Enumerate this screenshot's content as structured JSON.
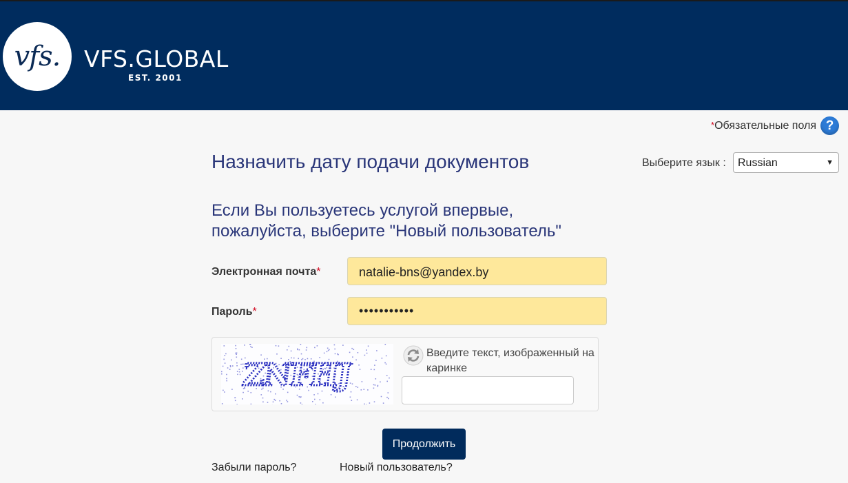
{
  "header": {
    "logo_mark": "vfs.",
    "brand": "VFS.GLOBAL",
    "est": "EST. 2001"
  },
  "required_note": {
    "star": "*",
    "text": "Обязательные поля"
  },
  "help_icon": "?",
  "icons": {
    "help": "question-circle-icon",
    "refresh": "refresh-icon",
    "select": "caret-down-icon"
  },
  "page_title": "Назначить дату подачи документов",
  "language": {
    "label": "Выберите язык :",
    "selected": "Russian"
  },
  "subtitle": {
    "line1": "Если Вы пользуетесь услугой впервые,",
    "line2": "пожалуйста, выберите \"Новый пользователь\""
  },
  "form": {
    "email_label": "Электронная почта",
    "email_value": "natalie-bns@yandex.by",
    "password_label": "Пароль",
    "password_value": "•••••••••••",
    "required_star": "*"
  },
  "captcha": {
    "text": "ZNFHJ",
    "prompt": "Введите текст, изображенный на каринке",
    "input_value": ""
  },
  "buttons": {
    "continue": "Продолжить"
  },
  "links": {
    "forgot": "Забыли пароль?",
    "new_user": "Новый пользователь?"
  },
  "colors": {
    "header_bg": "#002c5e",
    "heading": "#2a3679",
    "input_autofill": "#fee89b",
    "button_bg": "#012b5c",
    "help_blue": "#2d7bd6",
    "required_red": "#d0021b"
  }
}
